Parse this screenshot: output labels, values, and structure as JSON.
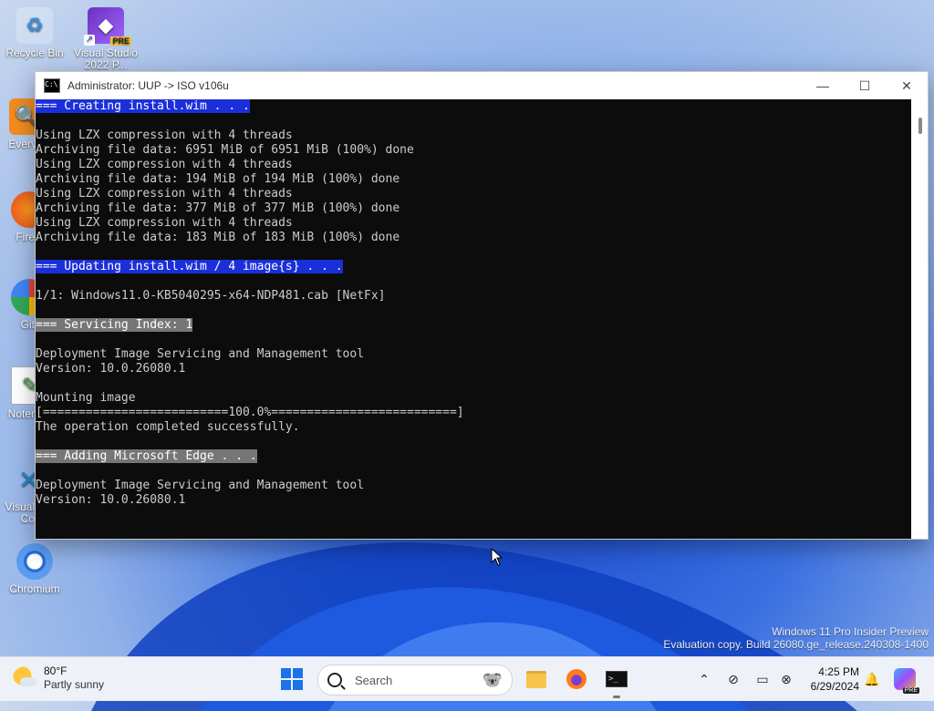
{
  "desktop": {
    "icons": [
      {
        "label": "Recycle Bin",
        "icon": "recycle-bin-icon"
      },
      {
        "label": "Visual Studio 2022 P...",
        "icon": "visual-studio-icon",
        "badge": "PRE"
      },
      {
        "label": "Every",
        "icon": "everything-search-icon"
      },
      {
        "label": "Fire",
        "icon": "firefox-icon"
      },
      {
        "label": "Git",
        "icon": "git-icon"
      },
      {
        "label": "Noter",
        "icon": "notepad-icon"
      },
      {
        "label": "Visual Co",
        "icon": "vscode-icon"
      },
      {
        "label": "Chromium",
        "icon": "chromium-icon"
      }
    ]
  },
  "window": {
    "title": "Administrator:  UUP -> ISO v106u",
    "controls": {
      "minimize": "—",
      "maximize": "☐",
      "close": "✕"
    },
    "console_lines": [
      {
        "text": "=== Creating install.wim . . .",
        "style": "blue"
      },
      {
        "text": "",
        "style": "plain"
      },
      {
        "text": "Using LZX compression with 4 threads",
        "style": "plain"
      },
      {
        "text": "Archiving file data: 6951 MiB of 6951 MiB (100%) done",
        "style": "plain"
      },
      {
        "text": "Using LZX compression with 4 threads",
        "style": "plain"
      },
      {
        "text": "Archiving file data: 194 MiB of 194 MiB (100%) done",
        "style": "plain"
      },
      {
        "text": "Using LZX compression with 4 threads",
        "style": "plain"
      },
      {
        "text": "Archiving file data: 377 MiB of 377 MiB (100%) done",
        "style": "plain"
      },
      {
        "text": "Using LZX compression with 4 threads",
        "style": "plain"
      },
      {
        "text": "Archiving file data: 183 MiB of 183 MiB (100%) done",
        "style": "plain"
      },
      {
        "text": "",
        "style": "plain"
      },
      {
        "text": "=== Updating install.wim / 4 image{s} . . .",
        "style": "blue"
      },
      {
        "text": "",
        "style": "plain"
      },
      {
        "text": "1/1: Windows11.0-KB5040295-x64-NDP481.cab [NetFx]",
        "style": "plain"
      },
      {
        "text": "",
        "style": "plain"
      },
      {
        "text": "=== Servicing Index: 1",
        "style": "gray"
      },
      {
        "text": "",
        "style": "plain"
      },
      {
        "text": "Deployment Image Servicing and Management tool",
        "style": "plain"
      },
      {
        "text": "Version: 10.0.26080.1",
        "style": "plain"
      },
      {
        "text": "",
        "style": "plain"
      },
      {
        "text": "Mounting image",
        "style": "plain"
      },
      {
        "text": "[==========================100.0%==========================]",
        "style": "plain"
      },
      {
        "text": "The operation completed successfully.",
        "style": "plain"
      },
      {
        "text": "",
        "style": "plain"
      },
      {
        "text": "=== Adding Microsoft Edge . . .",
        "style": "gray"
      },
      {
        "text": "",
        "style": "plain"
      },
      {
        "text": "Deployment Image Servicing and Management tool",
        "style": "plain"
      },
      {
        "text": "Version: 10.0.26080.1",
        "style": "plain"
      }
    ]
  },
  "watermark": {
    "line1": "Windows 11 Pro Insider Preview",
    "line2": "Evaluation copy. Build 26080.ge_release.240308-1400"
  },
  "taskbar": {
    "weather": {
      "temp": "80°F",
      "condition": "Partly sunny"
    },
    "search_placeholder": "Search",
    "clock": {
      "time": "4:25 PM",
      "date": "6/29/2024"
    },
    "copilot_badge": "PRE"
  },
  "colors": {
    "console_bg": "#0c0c0c",
    "highlight_blue": "#1a2fd9",
    "highlight_gray": "#767676",
    "accent": "#1a73e8"
  }
}
